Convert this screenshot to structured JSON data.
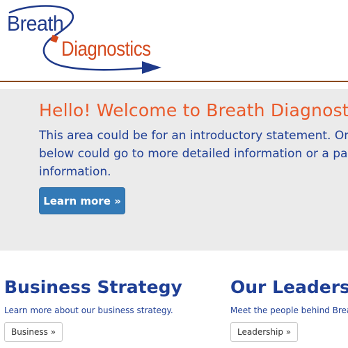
{
  "brand": {
    "word1": "Breath",
    "word2": "Diagnostics",
    "colors": {
      "blue": "#1f3a8a",
      "orange": "#d44a1e"
    }
  },
  "jumbotron": {
    "title": "Hello! Welcome to Breath Diagnostics",
    "lead_lines": [
      "This area could be for an introductory statement. Or",
      "below could go to more detailed information or a pa",
      "information."
    ],
    "button_label": "Learn more »"
  },
  "columns": [
    {
      "heading": "Business Strategy",
      "text": "Learn more about our business strategy.",
      "button_label": "Business »"
    },
    {
      "heading": "Our Leadership",
      "text": "Meet the people behind Breath Diagnostics.",
      "button_label": "Leadership »"
    }
  ]
}
